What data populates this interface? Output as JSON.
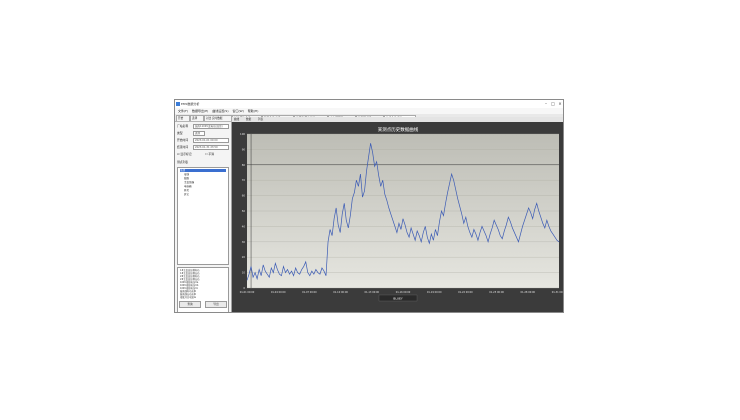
{
  "window": {
    "title": "EMS数据分析"
  },
  "menu": [
    "文件(F)",
    "数据导出(E)",
    "曲线设置(S)",
    "窗口(W)",
    "帮助(H)"
  ],
  "tabs": [
    "开始",
    "选择",
    "对比 实时数据",
    "对比 历史曲线 x",
    "趋势曲线 分析 x",
    "日报表 历史曲线 x",
    "电力潮流图 x",
    "功率图 参数 x",
    "分析曲线 查询 x"
  ],
  "subtabs": [
    "曲线",
    "数据",
    "列表"
  ],
  "panel": {
    "fields": [
      {
        "label": "厂站名称",
        "value": "城南110KV变电站(高压)"
      },
      {
        "label": "类型",
        "value": "遥测"
      },
      {
        "label": "开始时间",
        "value": "2023-01-01 00:00"
      },
      {
        "label": "结束时间",
        "value": "2023-01-31 23:59"
      }
    ],
    "options": {
      "check1": "显示标记",
      "check2": "平滑"
    },
    "tree_label": "测点列表",
    "tree": [
      "全部",
      "母线",
      "线路",
      "主变压器",
      "电容器",
      "开关",
      "其它"
    ],
    "list": [
      "1#主变高压侧有功",
      "1#主变高压侧无功",
      "2#主变高压侧有功",
      "2#主变高压侧无功",
      "10KV母线电压Ua",
      "10KV母线电压Ub",
      "10KV母线电压Uc",
      "城南线有功功率",
      "城南线无功功率",
      "母联开关电流Ia"
    ],
    "buttons": {
      "query": "查询",
      "export": "导出"
    }
  },
  "chart_data": {
    "type": "line",
    "title": "某测点历史数据曲线",
    "legend": "有功功率",
    "xlabel": "",
    "ylabel": "",
    "x_ticks": [
      "01-01 00:00",
      "01-04 00:00",
      "01-07 00:00",
      "01-10 00:00",
      "01-13 00:00",
      "01-16 00:00",
      "01-19 00:00",
      "01-22 00:00",
      "01-25 00:00",
      "01-28 00:00",
      "01-31 00:00"
    ],
    "ylim": [
      0,
      100
    ],
    "y_ticks": [
      0,
      10,
      20,
      30,
      40,
      50,
      60,
      70,
      80,
      90,
      100
    ],
    "hline": 80,
    "vline_index": 2,
    "series": [
      {
        "name": "有功功率",
        "color": "#3b5bb5",
        "values": [
          5,
          9,
          14,
          7,
          10,
          6,
          12,
          8,
          15,
          11,
          9,
          7,
          13,
          10,
          16,
          12,
          9,
          8,
          14,
          10,
          12,
          9,
          11,
          8,
          13,
          10,
          9,
          12,
          14,
          17,
          10,
          8,
          11,
          9,
          12,
          10,
          9,
          13,
          11,
          8,
          30,
          38,
          34,
          45,
          52,
          41,
          36,
          48,
          55,
          44,
          39,
          47,
          58,
          62,
          70,
          66,
          74,
          59,
          63,
          76,
          85,
          94,
          88,
          79,
          82,
          73,
          66,
          70,
          61,
          57,
          52,
          48,
          44,
          40,
          36,
          42,
          38,
          45,
          41,
          36,
          33,
          39,
          35,
          31,
          37,
          34,
          30,
          36,
          40,
          33,
          29,
          35,
          31,
          38,
          34,
          43,
          50,
          47,
          55,
          62,
          68,
          74,
          70,
          64,
          58,
          53,
          48,
          42,
          46,
          40,
          36,
          33,
          38,
          35,
          31,
          36,
          40,
          37,
          34,
          30,
          35,
          39,
          44,
          41,
          38,
          34,
          32,
          37,
          41,
          46,
          43,
          39,
          36,
          33,
          30,
          35,
          40,
          44,
          48,
          52,
          49,
          45,
          51,
          55,
          50,
          46,
          42,
          39,
          44,
          40,
          37,
          35,
          33,
          31,
          30
        ]
      }
    ]
  },
  "status_badge": "BLUEY"
}
